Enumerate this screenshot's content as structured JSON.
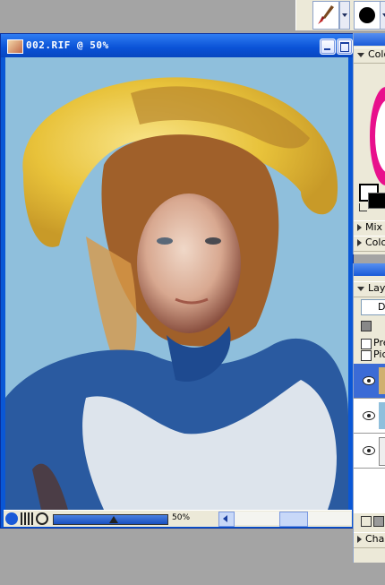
{
  "toolbar": {
    "brush_tool": "paintbrush-icon",
    "color_tool": "color-dot-icon"
  },
  "document": {
    "title": "002.RIF @ 50%",
    "zoom_value": "50%"
  },
  "colors_palette": {
    "header": "Colo",
    "mixer_label": "Mix",
    "color_sets_label": "Colo"
  },
  "layers_palette": {
    "header": "Lay",
    "composite_method": "De",
    "preserve_label": "Pre",
    "pick_up_label": "Pic",
    "channels_label": "Cha"
  },
  "colors": {
    "title_bar": "#0a52d6",
    "canvas_bg": "#8fbfdc",
    "panel_bg": "#ece9d8"
  }
}
